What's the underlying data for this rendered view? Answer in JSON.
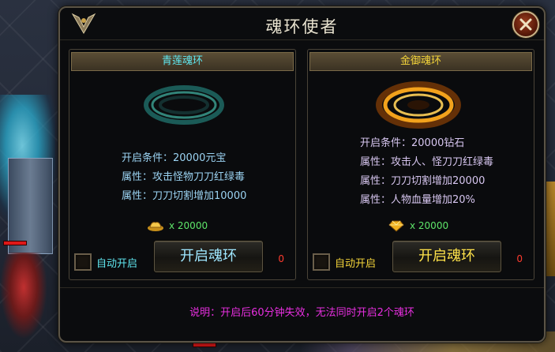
{
  "dialog": {
    "title": "魂环使者",
    "close_icon": "close-x-icon",
    "note": "说明：开启后60分钟失效，无法同时开启2个魂环"
  },
  "rings": [
    {
      "name": "青莲魂环",
      "ring_color": "#2a8f86",
      "condition": "开启条件：20000元宝",
      "attr1": "属性：攻击怪物刀刀红绿毒",
      "attr2": "属性：刀刀切割增加10000",
      "cost": "x 20000",
      "cost_icon": "gold-ingot-icon",
      "auto_label": "自动开启",
      "button": "开启魂环",
      "count": "0"
    },
    {
      "name": "金御魂环",
      "ring_color": "#f29a1c",
      "condition": "开启条件：20000钻石",
      "attr1": "属性：攻击人、怪刀刀红绿毒",
      "attr2": "属性：刀刀切割增加20000",
      "attr3": "属性：人物血量增加20%",
      "cost": "x 20000",
      "cost_icon": "diamond-gem-icon",
      "auto_label": "自动开启",
      "button": "开启魂环",
      "count": "0"
    }
  ]
}
